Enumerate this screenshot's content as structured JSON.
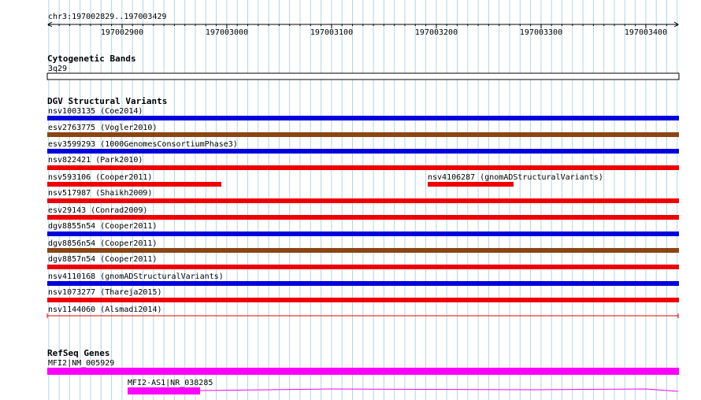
{
  "ruler": {
    "region": "chr3:197002829..197003429",
    "ticks": [
      "197002900",
      "197003000",
      "197003100",
      "197003200",
      "197003300",
      "197003400"
    ]
  },
  "cytoband": {
    "title": "Cytogenetic Bands",
    "band": "3q29"
  },
  "dgv": {
    "title": "DGV Structural Variants",
    "variants": [
      {
        "label": "nsv1003135 (Coe2014)",
        "color": "#0000dd"
      },
      {
        "label": "esv2763775 (Vogler2010)",
        "color": "#8b4513"
      },
      {
        "label": "esv3599293 (1000GenomesConsortiumPhase3)",
        "color": "#0000dd"
      },
      {
        "label": "nsv822421 (Park2010)",
        "color": "#ee0000"
      },
      {
        "label": "nsv593106 (Cooper2011)",
        "color": "#ee0000"
      },
      {
        "label": "nsv4106287 (gnomADStructuralVariants)",
        "color": "#ee0000"
      },
      {
        "label": "nsv517987 (Shaikh2009)",
        "color": "#ee0000"
      },
      {
        "label": "esv29143 (Conrad2009)",
        "color": "#ee0000"
      },
      {
        "label": "dgv8855n54 (Cooper2011)",
        "color": "#0000dd"
      },
      {
        "label": "dgv8856n54 (Cooper2011)",
        "color": "#8b4513"
      },
      {
        "label": "dgv8857n54 (Cooper2011)",
        "color": "#ee0000"
      },
      {
        "label": "nsv4110168 (gnomADStructuralVariants)",
        "color": "#0000dd"
      },
      {
        "label": "nsv1073277 (Thareja2015)",
        "color": "#ee0000"
      },
      {
        "label": "nsv1144060 (Alsmadi2014)",
        "color": "#ee0000"
      }
    ]
  },
  "refseq": {
    "title": "RefSeq Genes",
    "genes": [
      {
        "label": "MFI2|NM_005929",
        "color": "#ff00ff"
      },
      {
        "label": "MFI2-AS1|NR_038285",
        "color": "#ff00ff"
      }
    ]
  },
  "colors": {
    "grid": "#add8e6",
    "axis": "#000000"
  }
}
